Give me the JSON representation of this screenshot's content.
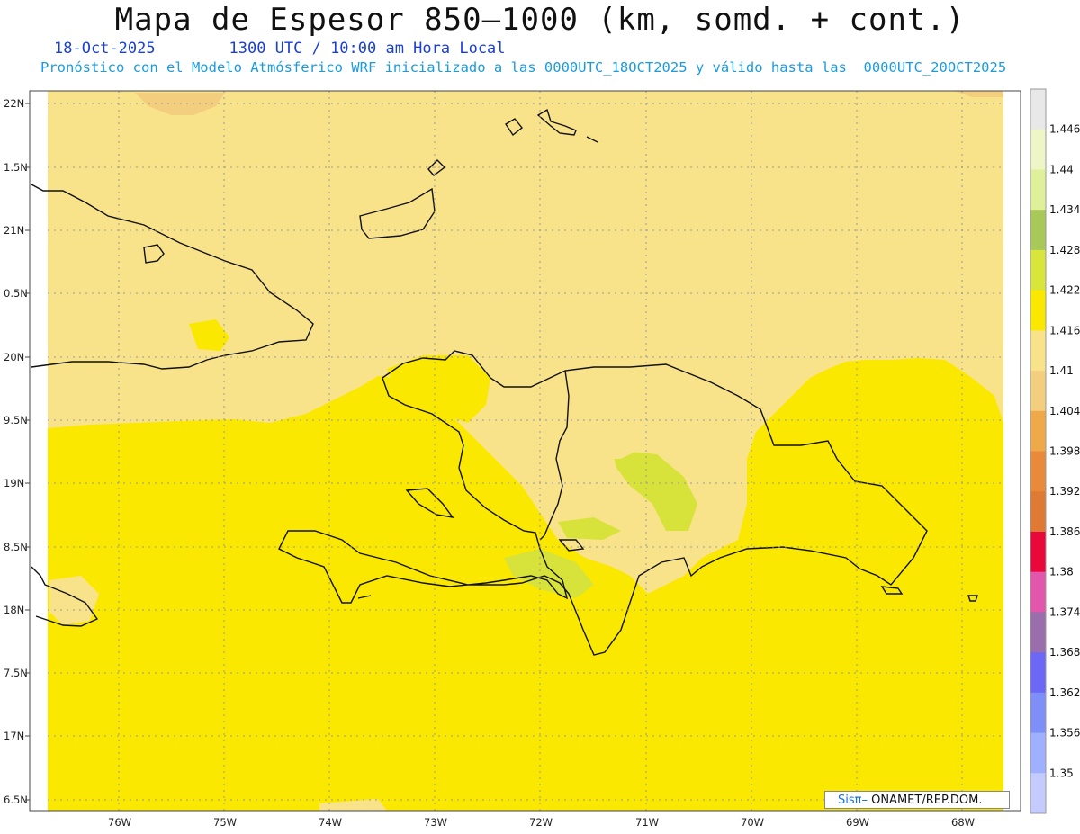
{
  "header": {
    "title": "Mapa de Espesor 850—1000 (km, somd. + cont.)",
    "date": "18-Oct-2025",
    "time": "1300 UTC / 10:00 am Hora Local",
    "description": "Pronóstico con el Modelo Atmósferico WRF inicializado a las 0000UTC_18OCT2025 y válido hasta las  0000UTC_20OCT2025"
  },
  "map": {
    "lat_labels": [
      "22N",
      "1.5N",
      "21N",
      "0.5N",
      "20N",
      "9.5N",
      "19N",
      "8.5N",
      "18N",
      "7.5N",
      "17N",
      "6.5N"
    ],
    "lon_labels": [
      "76W",
      "75W",
      "74W",
      "73W",
      "72W",
      "71W",
      "70W",
      "69W",
      "68W"
    ],
    "colors": {
      "base_yellow": "#fbe800",
      "light_tan": "#f9e38a",
      "tan": "#f3ce7e",
      "lime": "#d7e33a",
      "coast": "#111111"
    }
  },
  "colorbar": {
    "levels": [
      "1.446",
      "1.44",
      "1.434",
      "1.428",
      "1.422",
      "1.416",
      "1.41",
      "1.404",
      "1.398",
      "1.392",
      "1.386",
      "1.38",
      "1.374",
      "1.368",
      "1.362",
      "1.356",
      "1.35"
    ],
    "colors": [
      "#e8e8e8",
      "#eef5c6",
      "#dfef9a",
      "#a9c85a",
      "#d8e53a",
      "#fbe800",
      "#f9e38a",
      "#f3ce7e",
      "#eeaa4a",
      "#e9893a",
      "#de7a33",
      "#e8083c",
      "#e256ac",
      "#9a6eaa",
      "#6d67f5",
      "#7e8ff7",
      "#9fb0ff",
      "#c4ccff"
    ]
  },
  "credit": {
    "brand": "Sisπ–",
    "org": " ONAMET/REP.DOM."
  }
}
